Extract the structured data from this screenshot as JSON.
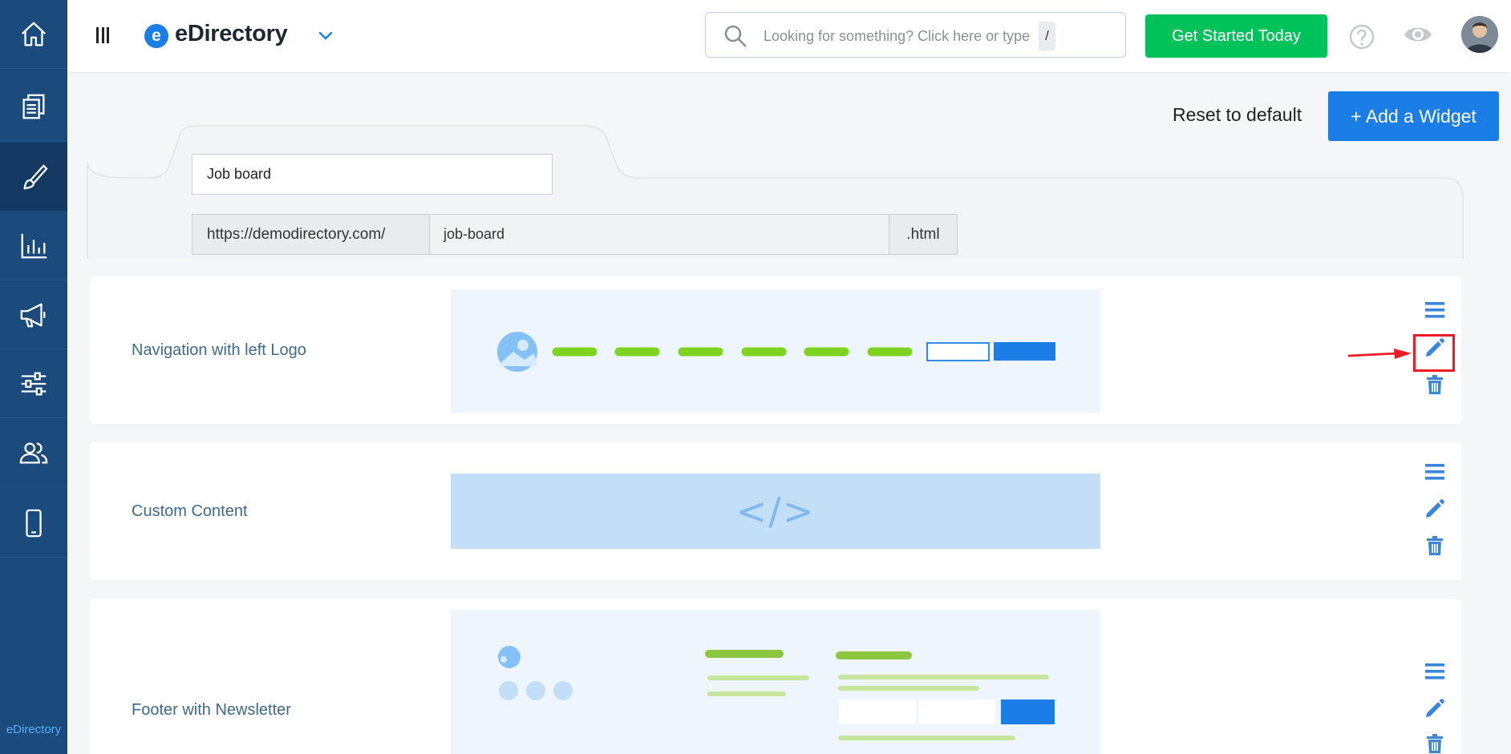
{
  "app": {
    "brand_letter": "e",
    "brand_name": "eDirectory",
    "sidebar_brand": "eDirectory"
  },
  "sidebar": {
    "items": [
      {
        "name": "home",
        "icon": "home-icon"
      },
      {
        "name": "content",
        "icon": "documents-icon"
      },
      {
        "name": "design",
        "icon": "brush-icon",
        "active": true
      },
      {
        "name": "reports",
        "icon": "bar-chart-icon"
      },
      {
        "name": "promote",
        "icon": "megaphone-icon"
      },
      {
        "name": "settings",
        "icon": "sliders-icon"
      },
      {
        "name": "users",
        "icon": "users-icon"
      },
      {
        "name": "mobile",
        "icon": "mobile-icon"
      }
    ]
  },
  "header": {
    "search_placeholder": "Looking for something? Click here or type",
    "search_key": "/",
    "cta_label": "Get Started Today"
  },
  "actions": {
    "reset_label": "Reset to default",
    "add_widget_label": "+ Add a Widget"
  },
  "page": {
    "title": "Job board",
    "url_prefix": "https://demodirectory.com/",
    "url_slug": "job-board",
    "url_suffix": ".html"
  },
  "widgets": [
    {
      "title": "Navigation with left Logo"
    },
    {
      "title": "Custom Content",
      "preview_symbol": "</>"
    },
    {
      "title": "Footer with Newsletter"
    }
  ],
  "colors": {
    "sidebar": "#1b4a7c",
    "accent": "#1a7ee6",
    "cta": "#00c25a",
    "highlight": "#ee1b24",
    "preview_green": "#84cc16"
  }
}
